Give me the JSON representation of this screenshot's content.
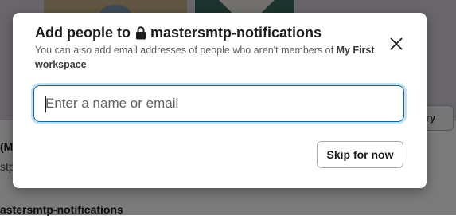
{
  "background": {
    "sort_label": "ry",
    "row_title": "(M",
    "row_subtitle": "stp",
    "channel_label": "astersmtp-notifications"
  },
  "modal": {
    "title_prefix": "Add people to",
    "channel_name": "mastersmtp-notifications",
    "subtitle_text": "You can also add email addresses of people who aren't members of",
    "workspace_name": "My First workspace",
    "search": {
      "placeholder": "Enter a name or email",
      "value": ""
    },
    "skip_label": "Skip for now",
    "icons": {
      "lock": "lock-icon",
      "close": "close-icon"
    }
  },
  "colors": {
    "focus_ring": "#1264a3",
    "text_primary": "#1d1c1d",
    "text_secondary": "#616061"
  }
}
